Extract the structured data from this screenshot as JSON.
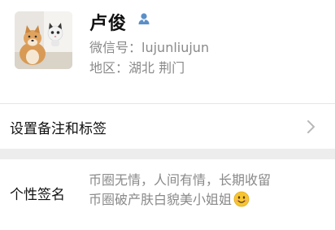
{
  "profile": {
    "name": "卢俊",
    "wechat_id_label": "微信号：",
    "wechat_id": "lujunliujun",
    "region_label": "地区：",
    "region": "湖北 荆门",
    "gender_icon": "male-user-icon",
    "avatar": "shiba-dog-and-cat-photo"
  },
  "rows": {
    "remark_label": "设置备注和标签",
    "signature_label": "个性签名",
    "signature_line1": "币圈无情，人间有情，长期收留",
    "signature_line2": "币圈破产肤白貌美小姐姐"
  },
  "colors": {
    "accent_blue": "#5b8fc7",
    "secondary_text": "#8a8a8a",
    "separator": "#ededed"
  }
}
